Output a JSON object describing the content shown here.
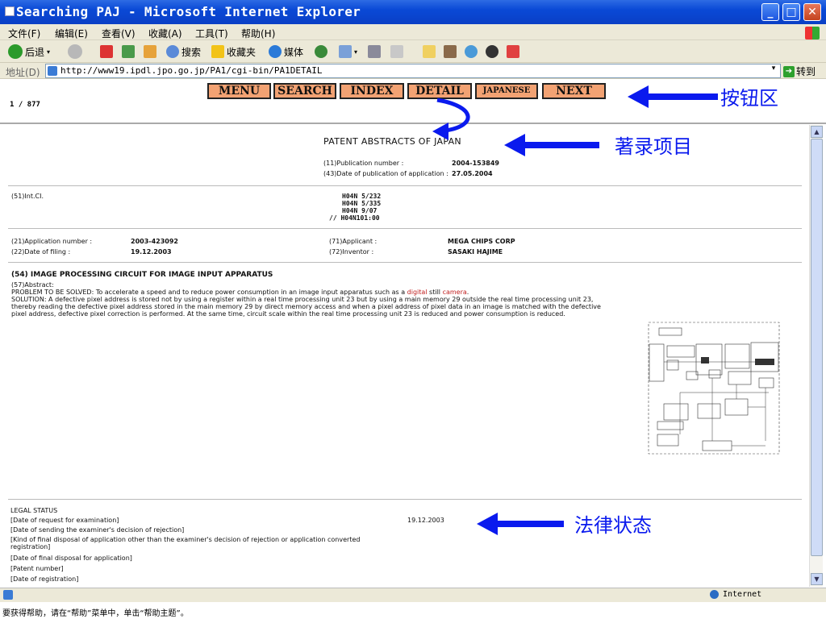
{
  "window": {
    "title": "Searching PAJ - Microsoft Internet Explorer",
    "min": "_",
    "max": "□",
    "close": "✕"
  },
  "menu": [
    "文件(F)",
    "编辑(E)",
    "查看(V)",
    "收藏(A)",
    "工具(T)",
    "帮助(H)"
  ],
  "toolbar": {
    "back": "后退",
    "search": "搜索",
    "favorites": "收藏夹",
    "media": "媒体"
  },
  "address": {
    "label": "地址(D)",
    "url": "http://www19.ipdl.jpo.go.jp/PA1/cgi-bin/PA1DETAIL",
    "go": "转到"
  },
  "nav": {
    "pager": "1 / 877",
    "buttons": [
      "MENU",
      "SEARCH",
      "INDEX",
      "DETAIL",
      "JAPANESE",
      "NEXT"
    ]
  },
  "annotations": {
    "buttons": "按钮区",
    "bibliographic": "著录项目",
    "legal": "法律状态"
  },
  "patent": {
    "heading": "PATENT ABSTRACTS OF JAPAN",
    "pub_no_label": "(11)Publication number :",
    "pub_no": "2004-153849",
    "pub_date_label": "(43)Date of publication of application :",
    "pub_date": "27.05.2004",
    "intcl_label": "(51)Int.CI.",
    "intcl": [
      "H04N  5/232",
      "H04N  5/335",
      "H04N  9/07",
      "// H04N101:00"
    ],
    "app_no_label": "(21)Application number :",
    "app_no": "2003-423092",
    "applicant_label": "(71)Applicant :",
    "applicant": "MEGA CHIPS CORP",
    "filing_label": "(22)Date of filing :",
    "filing": "19.12.2003",
    "inventor_label": "(72)Inventor :",
    "inventor": "SASAKI HAJIME",
    "title": "(54) IMAGE PROCESSING CIRCUIT FOR IMAGE INPUT APPARATUS",
    "abstract_label": "(57)Abstract:",
    "problem_pre": "PROBLEM TO BE SOLVED: To accelerate a speed and to reduce power consumption in an image input apparatus such as a ",
    "problem_digital": "digital",
    "problem_mid": " still ",
    "problem_camera": "camera",
    "problem_post": ".",
    "solution": "SOLUTION: A defective pixel address is stored not by using a register within a real time processing unit 23 but by using a main memory 29 outside the real time processing unit 23, thereby reading the defective pixel address stored in the main memory 29 by direct memory access and when a pixel address of pixel data in an image is matched with the defective pixel address, defective pixel correction is performed. At the same time, circuit scale within the real time processing unit 23 is reduced and power consumption is reduced."
  },
  "legal": {
    "heading": "LEGAL STATUS",
    "rows": [
      "[Date of request for examination]",
      "[Date of sending the examiner's decision of rejection]",
      "[Kind of final disposal of application other than the examiner's decision of rejection or application converted registration]",
      "[Date of final disposal for application]",
      "[Patent number]",
      "[Date of registration]"
    ],
    "request_date": "19.12.2003"
  },
  "status": {
    "zone": "Internet",
    "help": "要获得帮助，请在“帮助”菜单中，单击“帮助主题”。"
  }
}
